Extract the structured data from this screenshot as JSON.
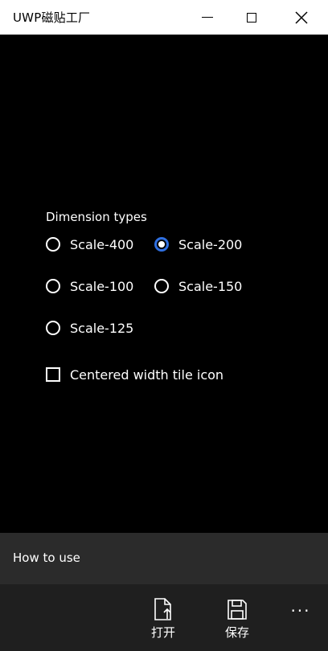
{
  "window": {
    "title": "UWP磁贴工厂"
  },
  "options": {
    "section_label": "Dimension types",
    "radios": [
      {
        "label": "Scale-400",
        "checked": false
      },
      {
        "label": "Scale-200",
        "checked": true
      },
      {
        "label": "Scale-100",
        "checked": false
      },
      {
        "label": "Scale-150",
        "checked": false
      },
      {
        "label": "Scale-125",
        "checked": false
      }
    ],
    "checkbox_label": "Centered width tile icon",
    "checkbox_checked": false
  },
  "footer": {
    "howto_label": "How to use"
  },
  "appbar": {
    "open_label": "打开",
    "save_label": "保存",
    "more_label": "···",
    "open_icon": "open-file-icon",
    "save_icon": "save-icon"
  },
  "colors": {
    "accent": "#2f6fe0",
    "background": "#000000",
    "howto_bar": "#2b2b2b",
    "appbar": "#1f1f1f"
  }
}
